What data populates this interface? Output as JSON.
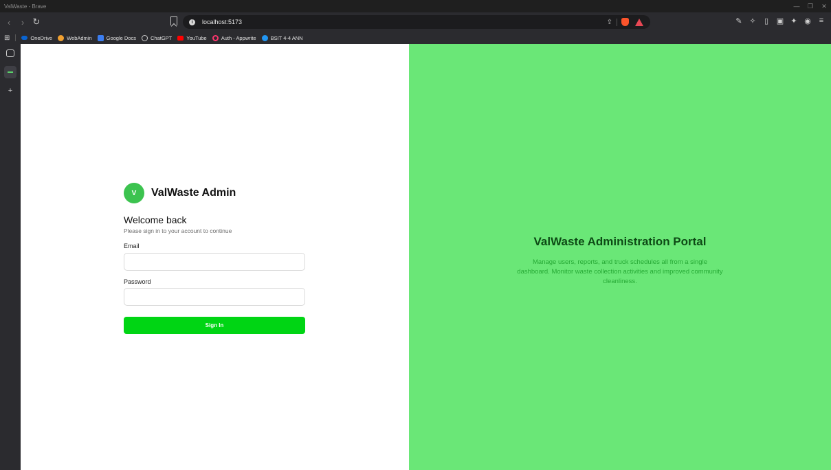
{
  "window": {
    "title": "ValWaste - Brave"
  },
  "navbar": {
    "url": "localhost:5173"
  },
  "bookmarks": [
    {
      "label": "OneDrive",
      "color": "#0a64d0"
    },
    {
      "label": "WebAdmin",
      "color": "#f0a030"
    },
    {
      "label": "Google Docs",
      "color": "#3b7df0"
    },
    {
      "label": "ChatGPT",
      "color": "#cfcfcf"
    },
    {
      "label": "YouTube",
      "color": "#ff0000"
    },
    {
      "label": "Auth - Appwrite",
      "color": "#fd366e"
    },
    {
      "label": "BSIT 4-4 ANN",
      "color": "#2196f3"
    }
  ],
  "login": {
    "logo_letter": "V",
    "brand_name": "ValWaste Admin",
    "welcome": "Welcome back",
    "subtitle": "Please sign in to your account to continue",
    "email_label": "Email",
    "email_value": "",
    "password_label": "Password",
    "password_value": "",
    "sign_in_label": "Sign In"
  },
  "portal": {
    "title": "ValWaste Administration Portal",
    "description": "Manage users, reports, and truck schedules all from a single dashboard. Monitor waste collection activities and improved community cleanliness."
  },
  "colors": {
    "accent": "#00d514",
    "panel_bg": "#6ae777",
    "logo_bg": "#3cc34f"
  }
}
